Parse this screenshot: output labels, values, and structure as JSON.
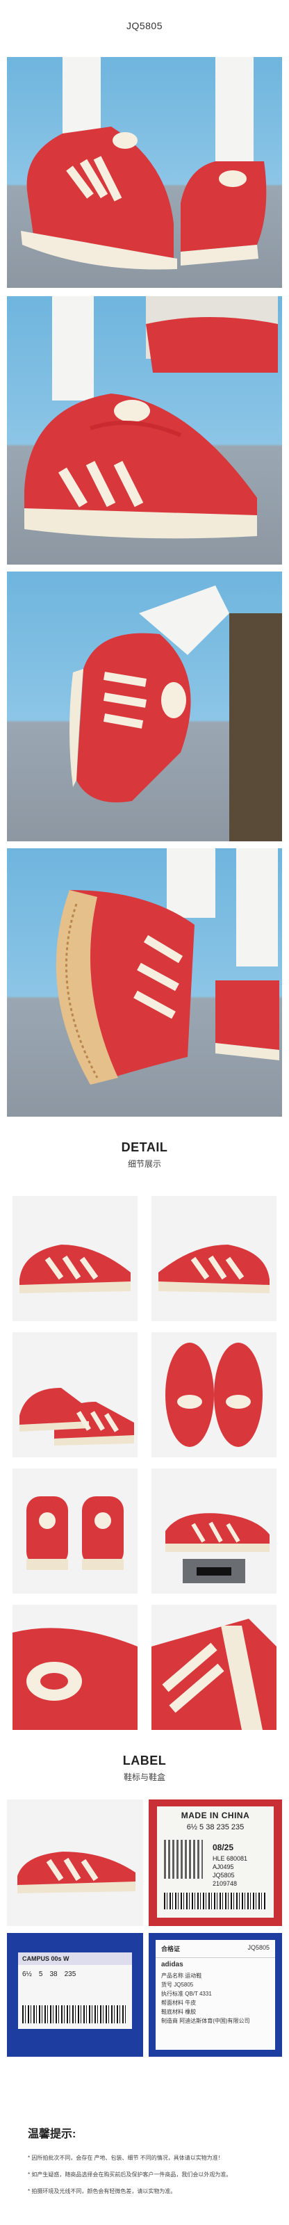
{
  "header": {
    "product_code": "JQ5805"
  },
  "detail": {
    "title_en": "DETAIL",
    "title_cn": "细节展示"
  },
  "label_section": {
    "title_en": "LABEL",
    "title_cn": "鞋标与鞋盒"
  },
  "tongue_label": {
    "made_in": "MADE IN CHINA",
    "sizes": "6½  5  38  235 235",
    "date": "08/25",
    "codes": [
      "HLE 680081",
      "AJ0495",
      "JQ5805",
      "2109748"
    ],
    "size_row_code": "JQ5805"
  },
  "box_label": {
    "model": "CAMPUS 00s W",
    "size_us": "6½",
    "size_uk": "5",
    "size_eu": "38",
    "size_jp": "235"
  },
  "certificate": {
    "title": "合格证",
    "brand": "adidas",
    "code": "JQ5805",
    "lines": [
      "产品名称 运动鞋",
      "货号 JQ5805",
      "执行标准 QB/T 4331",
      "帮面材料 牛皮",
      "鞋底材料 橡胶",
      "制造商 阿迪达斯体育(中国)有限公司"
    ]
  },
  "tips": {
    "title": "温馨提示:",
    "lines": [
      "* 因所拍批次不同，会存在 产地、包装、细节 不同的情况，具体请以实物为准！",
      "* 如产生疑惑，随商品选择会在购买前后及保护客户一件商品，我们会以外观为准。",
      "* 拍摄环境及光线不同，颜色会有轻微色差，请以实物为准。"
    ]
  }
}
